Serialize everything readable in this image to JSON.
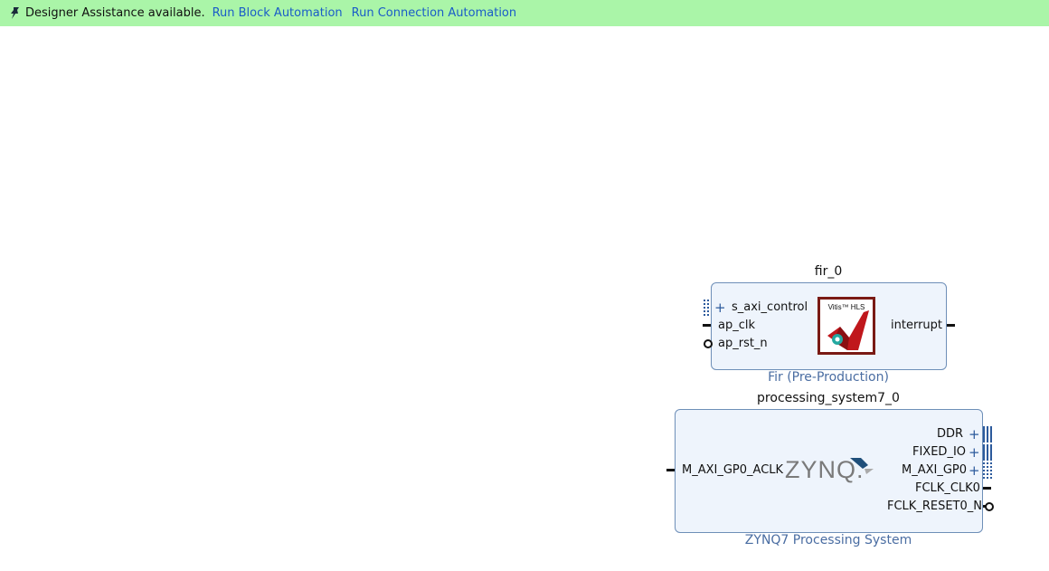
{
  "banner": {
    "message": "Designer Assistance available.",
    "run_block_automation": "Run Block Automation",
    "run_connection_automation": "Run Connection Automation",
    "bg_color": "#aaf5a8",
    "link_color": "#1a5cc8"
  },
  "fir_block": {
    "instance_name": "fir_0",
    "ip_name": "Fir (Pre-Production)",
    "logo_text": "Vitis™ HLS",
    "ports_left": [
      "s_axi_control",
      "ap_clk",
      "ap_rst_n"
    ],
    "ports_right": [
      "interrupt"
    ]
  },
  "ps_block": {
    "instance_name": "processing_system7_0",
    "ip_name": "ZYNQ7 Processing System",
    "logo_text": "ZYNQ.",
    "ports_left": [
      "M_AXI_GP0_ACLK"
    ],
    "ports_right": [
      "DDR",
      "FIXED_IO",
      "M_AXI_GP0",
      "FCLK_CLK0",
      "FCLK_RESET0_N"
    ]
  }
}
